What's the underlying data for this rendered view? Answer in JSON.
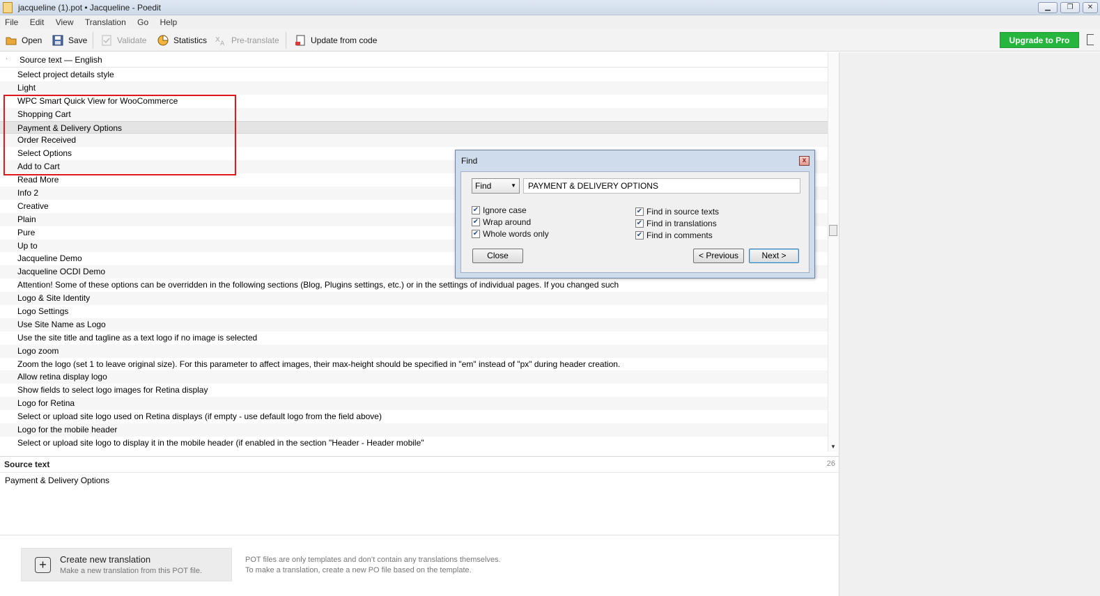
{
  "window": {
    "title": "jacqueline (1).pot • Jacqueline - Poedit",
    "min_icon": "minimize-icon",
    "restore_icon": "restore-icon",
    "close_icon": "close-icon"
  },
  "menu": [
    "File",
    "Edit",
    "View",
    "Translation",
    "Go",
    "Help"
  ],
  "toolbar": {
    "open": "Open",
    "save": "Save",
    "validate": "Validate",
    "statistics": "Statistics",
    "pretranslate": "Pre-translate",
    "update": "Update from code",
    "upgrade": "Upgrade to Pro"
  },
  "list": {
    "header": "Source text — English",
    "rows": [
      "Select project details style",
      "Light",
      "WPC Smart Quick View for WooCommerce",
      "Shopping Cart",
      "Payment & Delivery Options",
      "Order Received",
      "Select Options",
      "Add to Cart",
      "Read More",
      "Info 2",
      "Creative",
      "Plain",
      "Pure",
      "Up to",
      "Jacqueline Demo",
      "Jacqueline OCDI Demo",
      "Attention! Some of these options can be overridden in the following sections (Blog, Plugins settings, etc.) or in the settings of individual pages. If you changed such",
      "Logo & Site Identity",
      "Logo Settings",
      "Use Site Name as Logo",
      "Use the site title and tagline as a text logo if no image is selected",
      "Logo zoom",
      "Zoom the logo (set 1 to leave original size). For this parameter to affect images, their max-height should be specified in \"em\" instead of \"px\" during header creation.",
      "Allow retina display logo",
      "Show fields to select logo images for Retina display",
      "Logo for Retina",
      "Select or upload site logo used on Retina displays (if empty - use default logo from the field above)",
      "Logo for the mobile header",
      "Select or upload site logo to display it in the mobile header (if enabled in the section \"Header - Header mobile\""
    ],
    "selected_index": 4
  },
  "source_pane": {
    "label": "Source text",
    "count": "26",
    "text": "Payment & Delivery Options"
  },
  "bottom": {
    "create_title": "Create new translation",
    "create_sub": "Make a new translation from this POT file.",
    "note_line1": "POT files are only templates and don’t contain any translations themselves.",
    "note_line2": "To make a translation, create a new PO file based on the template."
  },
  "find_dialog": {
    "title": "Find",
    "mode": "Find",
    "query": "PAYMENT & DELIVERY OPTIONS",
    "options_left": [
      {
        "label": "Ignore case",
        "checked": true
      },
      {
        "label": "Wrap around",
        "checked": true
      },
      {
        "label": "Whole words only",
        "checked": true
      }
    ],
    "options_right": [
      {
        "label": "Find in source texts",
        "checked": true
      },
      {
        "label": "Find in translations",
        "checked": true
      },
      {
        "label": "Find in comments",
        "checked": true
      }
    ],
    "close": "Close",
    "previous": "< Previous",
    "next": "Next >"
  },
  "colors": {
    "highlight_box": "#e0181c",
    "upgrade_button": "#27b63d"
  }
}
